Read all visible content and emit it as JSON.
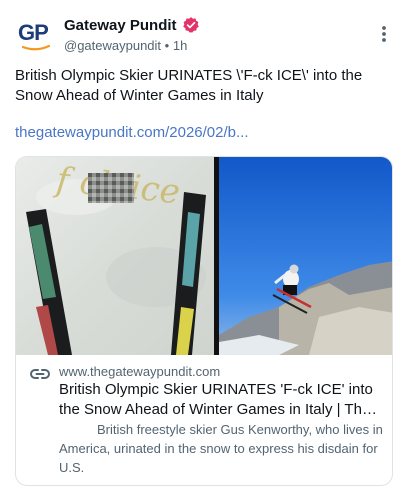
{
  "post": {
    "author_name": "Gateway Pundit",
    "handle": "@gatewaypundit",
    "time": "1h",
    "separator": "•",
    "avatar_text": "GP",
    "text": "British Olympic Skier URINATES \\'F-ck ICE\\' into the Snow Ahead of Winter Games in Italy",
    "link": "thegatewaypundit.com/2026/02/b..."
  },
  "card": {
    "domain": "www.thegatewaypundit.com",
    "title_line1": "British Olympic Skier URINATES 'F-ck ICE' into",
    "title_line2": "the Snow Ahead of Winter Games in Italy | The ...",
    "description": "British freestyle skier Gus Kenworthy, who lives in America, urinated in the snow to express his disdain for U.S.",
    "snow_writing": "f ck ice"
  },
  "colors": {
    "link": "#4a76c7",
    "verified": "#e2336b",
    "brand_blue": "#1c3d78",
    "brand_orange": "#f39a1e",
    "sky": "#1f6fe0"
  },
  "icons": {
    "verified": "verified-badge-icon",
    "more": "more-vertical-icon",
    "link": "link-chain-icon"
  }
}
